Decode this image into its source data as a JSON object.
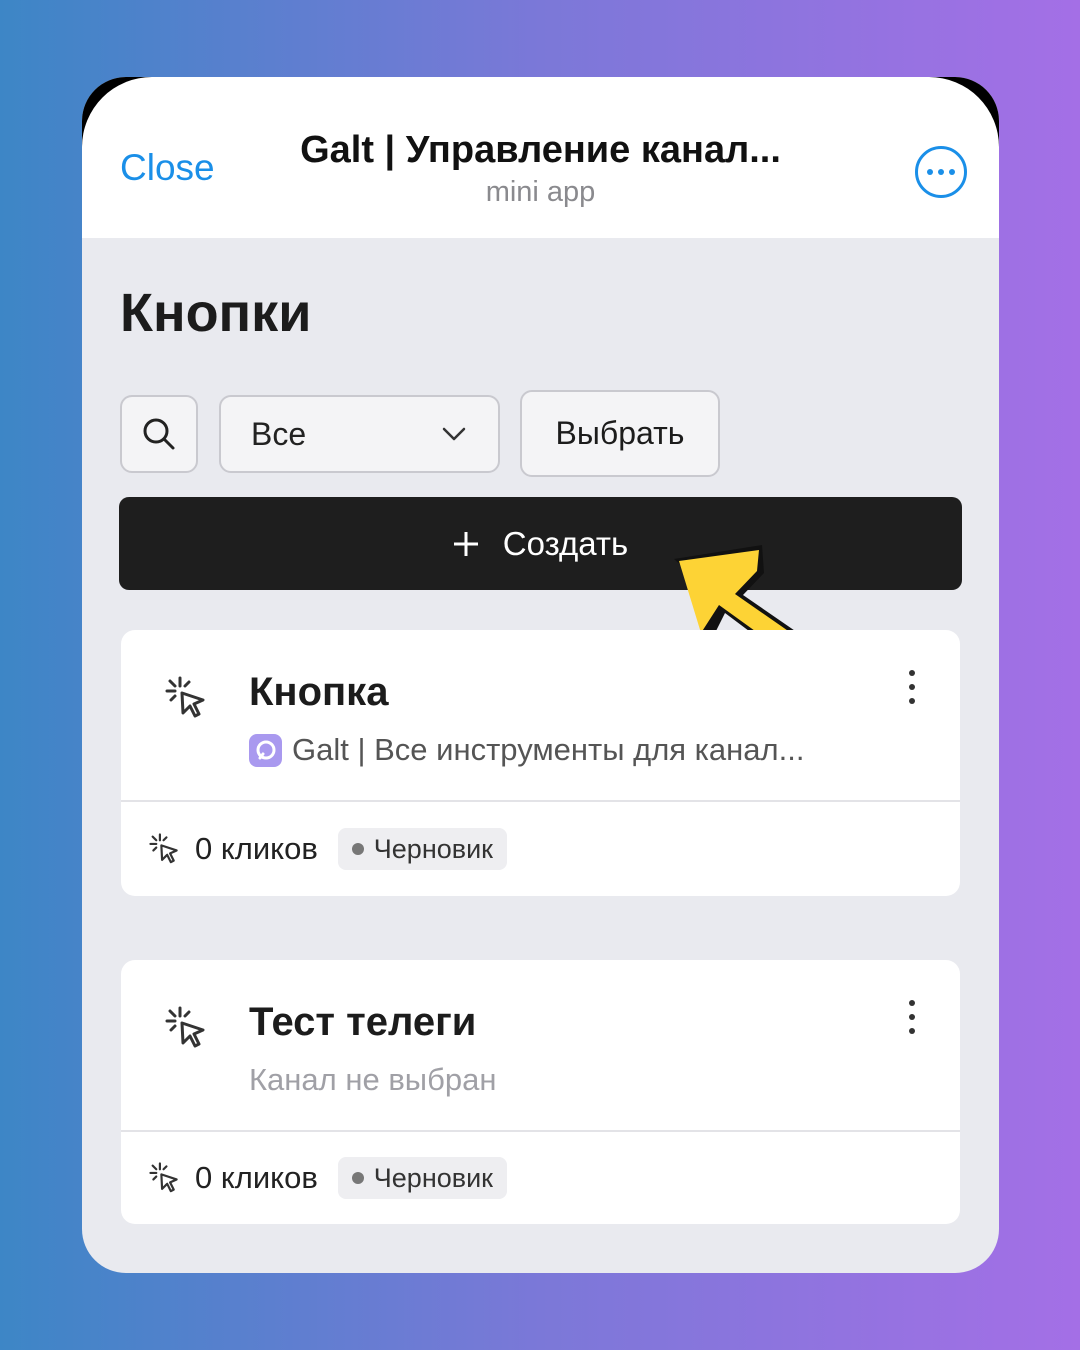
{
  "header": {
    "close_label": "Close",
    "title": "Galt | Управление канал...",
    "subtitle": "mini app",
    "more_icon": "ellipsis-icon"
  },
  "page": {
    "title": "Кнопки"
  },
  "toolbar": {
    "search_icon": "search-icon",
    "filter_value": "Все",
    "select_label": "Выбрать",
    "create_label": "Создать"
  },
  "cards": [
    {
      "title": "Кнопка",
      "channel": "Galt | Все инструменты для канал...",
      "clicks": "0 кликов",
      "status": "Черновик"
    },
    {
      "title": "Тест телеги",
      "channel": "Канал не выбран",
      "clicks": "0 кликов",
      "status": "Черновик"
    }
  ],
  "colors": {
    "accent": "#1a8fe8",
    "create_bg": "#1e1e1e",
    "arrow": "#fdd335"
  }
}
